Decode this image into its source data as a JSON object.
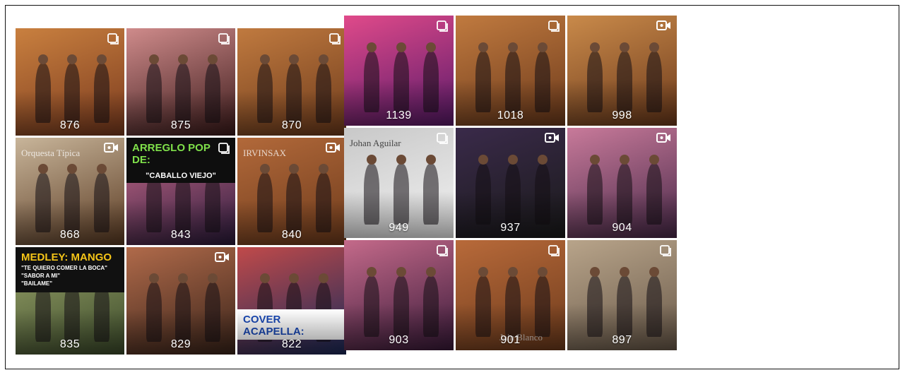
{
  "left_grid": {
    "tiles": [
      {
        "count": "876",
        "badge": "multiple-icon",
        "colors": [
          "#7a3a1e",
          "#c9803f"
        ]
      },
      {
        "count": "875",
        "badge": "multiple-icon",
        "colors": [
          "#3b1a1a",
          "#cf8b8b"
        ]
      },
      {
        "count": "870",
        "badge": "multiple-icon",
        "colors": [
          "#6e3b1c",
          "#c07a3f"
        ]
      },
      {
        "count": "868",
        "badge": "video-icon",
        "banner": "Orquesta Típica",
        "colors": [
          "#5a3a22",
          "#c8b59a"
        ]
      },
      {
        "count": "843",
        "badge": "multiple-icon",
        "banner_title": "ARREGLO POP DE:",
        "banner_sub": "\"CABALLO VIEJO\"",
        "colors": [
          "#2a1a3a",
          "#c86a8a"
        ]
      },
      {
        "count": "840",
        "badge": "video-icon",
        "banner": "IRVINSAX",
        "colors": [
          "#6e3b1c",
          "#b2693a"
        ]
      },
      {
        "count": "835",
        "badge": "",
        "banner_title": "MEDLEY: MANGO",
        "banner_lines": [
          "\"TE QUIERO COMER LA BOCA\"",
          "\"SABOR A MI\"",
          "\"BAILAME\""
        ],
        "colors": [
          "#3b4a2a",
          "#9aa46a"
        ]
      },
      {
        "count": "829",
        "badge": "video-icon",
        "colors": [
          "#3a241a",
          "#b06a4a"
        ]
      },
      {
        "count": "822",
        "badge": "",
        "banner_title": "COVER ACAPELLA:",
        "colors": [
          "#1a2a5a",
          "#c04a4a"
        ]
      }
    ]
  },
  "right_grid": {
    "tiles": [
      {
        "count": "1139",
        "badge": "multiple-icon",
        "colors": [
          "#5a1a6a",
          "#e04a8a"
        ]
      },
      {
        "count": "1018",
        "badge": "multiple-icon",
        "colors": [
          "#6e3b1c",
          "#c07a3f"
        ]
      },
      {
        "count": "998",
        "badge": "video-icon",
        "colors": [
          "#6e3b1c",
          "#c98a4a"
        ]
      },
      {
        "count": "949",
        "badge": "multiple-icon",
        "banner": "Johan Aguilar",
        "colors": [
          "#f2f2f2",
          "#c8c8c8"
        ]
      },
      {
        "count": "937",
        "badge": "video-icon",
        "colors": [
          "#1a1a1a",
          "#3a2a4a"
        ]
      },
      {
        "count": "904",
        "badge": "video-icon",
        "colors": [
          "#4a2a4a",
          "#c87a9a"
        ]
      },
      {
        "count": "903",
        "badge": "multiple-icon",
        "colors": [
          "#3a1a3a",
          "#c46a8a"
        ]
      },
      {
        "count": "901",
        "badge": "multiple-icon",
        "banner": "Jain Blanco",
        "colors": [
          "#6e3b1c",
          "#b86a3a"
        ]
      },
      {
        "count": "897",
        "badge": "multiple-icon",
        "colors": [
          "#6a5a4a",
          "#b8a48a"
        ]
      }
    ]
  }
}
